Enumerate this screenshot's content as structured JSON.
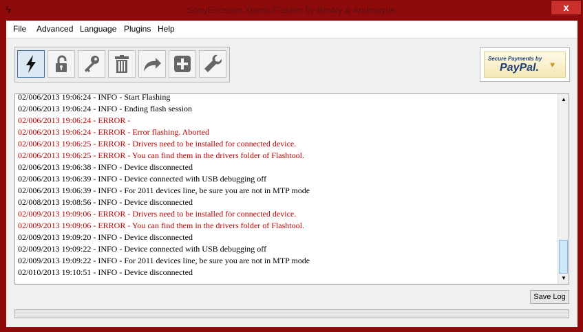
{
  "window": {
    "title": "SonyEricsson Xperia Flasher by Bin4ry & Androxyde",
    "close_label": "x"
  },
  "menu": [
    "File",
    "Advanced",
    "Language",
    "Plugins",
    "Help"
  ],
  "toolbar": {
    "buttons": [
      {
        "name": "flash-icon",
        "active": true
      },
      {
        "name": "unlock-icon",
        "active": false
      },
      {
        "name": "key-icon",
        "active": false
      },
      {
        "name": "trash-icon",
        "active": false
      },
      {
        "name": "redo-arrow-icon",
        "active": false
      },
      {
        "name": "plus-icon",
        "active": false
      },
      {
        "name": "wrench-icon",
        "active": false
      }
    ]
  },
  "paypal": {
    "top_text": "Secure Payments by",
    "brand": "PayPal."
  },
  "log": {
    "lines": [
      {
        "text": "02/006/2013 19:06:24 - INFO  - Start Flashing",
        "level": "info"
      },
      {
        "text": "02/006/2013 19:06:24 - INFO  - Ending flash session",
        "level": "info"
      },
      {
        "text": "02/006/2013 19:06:24 - ERROR -",
        "level": "error"
      },
      {
        "text": "02/006/2013 19:06:24 - ERROR - Error flashing. Aborted",
        "level": "error"
      },
      {
        "text": "02/006/2013 19:06:25 - ERROR - Drivers need to be installed for connected device.",
        "level": "error"
      },
      {
        "text": "02/006/2013 19:06:25 - ERROR - You can find them in the drivers folder of Flashtool.",
        "level": "error"
      },
      {
        "text": "02/006/2013 19:06:38 - INFO  - Device disconnected",
        "level": "info"
      },
      {
        "text": "02/006/2013 19:06:39 - INFO  - Device connected with USB debugging off",
        "level": "info"
      },
      {
        "text": "02/006/2013 19:06:39 - INFO  - For 2011 devices line, be sure you are not in MTP mode",
        "level": "info"
      },
      {
        "text": "02/008/2013 19:08:56 - INFO  - Device disconnected",
        "level": "info"
      },
      {
        "text": "02/009/2013 19:09:06 - ERROR - Drivers need to be installed for connected device.",
        "level": "error"
      },
      {
        "text": "02/009/2013 19:09:06 - ERROR - You can find them in the drivers folder of Flashtool.",
        "level": "error"
      },
      {
        "text": "02/009/2013 19:09:20 - INFO  - Device disconnected",
        "level": "info"
      },
      {
        "text": "02/009/2013 19:09:22 - INFO  - Device connected with USB debugging off",
        "level": "info"
      },
      {
        "text": "02/009/2013 19:09:22 - INFO  - For 2011 devices line, be sure you are not in MTP mode",
        "level": "info"
      },
      {
        "text": "02/010/2013 19:10:51 - INFO  - Device disconnected",
        "level": "info"
      }
    ]
  },
  "buttons": {
    "save_log": "Save Log"
  },
  "progress": {
    "fraction": 0
  }
}
